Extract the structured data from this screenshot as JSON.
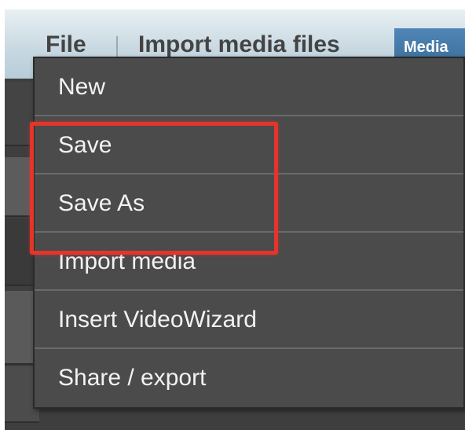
{
  "menubar": {
    "file_label": "File",
    "import_label": "Import media files",
    "media_tab_label": "Media"
  },
  "file_menu": {
    "items": [
      {
        "label": "New"
      },
      {
        "label": "Save"
      },
      {
        "label": "Save As"
      },
      {
        "label": "Import media"
      },
      {
        "label": "Insert VideoWizard"
      },
      {
        "label": "Share / export"
      }
    ]
  },
  "annotation": {
    "highlight_color": "#e3352b",
    "highlighted_items": [
      "Save",
      "Save As"
    ]
  },
  "colors": {
    "menu_background": "#4b4b4b",
    "menu_text": "#f2f2f2",
    "menubar_text": "#444444",
    "media_tab": "#4f86b6"
  }
}
